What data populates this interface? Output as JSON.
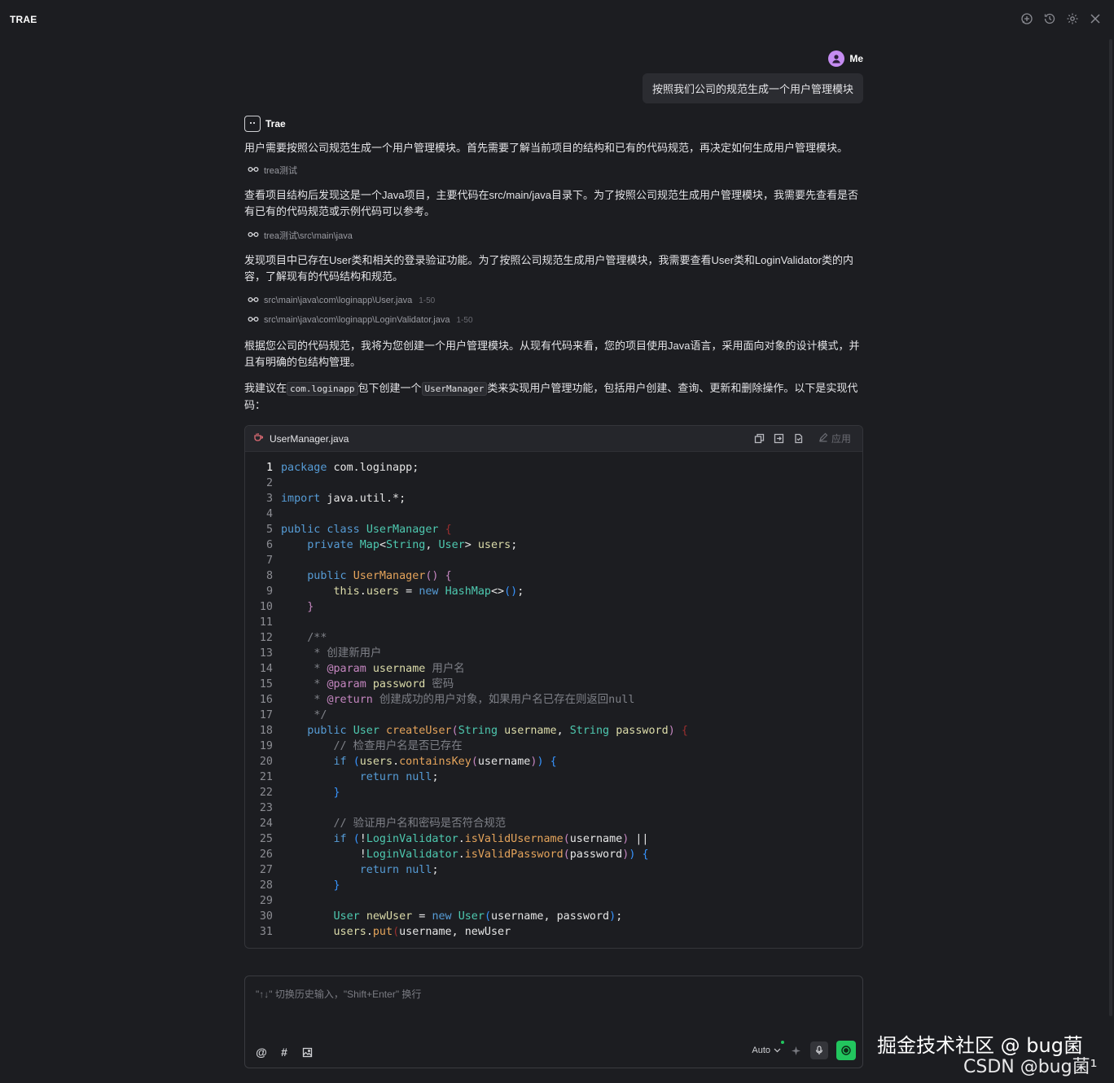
{
  "app": {
    "brand": "TRAE"
  },
  "user": {
    "name": "Me",
    "message": "按照我们公司的规范生成一个用户管理模块"
  },
  "assistant": {
    "name": "Trae",
    "p1": "用户需要按照公司规范生成一个用户管理模块。首先需要了解当前项目的结构和已有的代码规范，再决定如何生成用户管理模块。",
    "ref1": "trea测试",
    "p2": "查看项目结构后发现这是一个Java项目，主要代码在src/main/java目录下。为了按照公司规范生成用户管理模块，我需要先查看是否有已有的代码规范或示例代码可以参考。",
    "ref2": "trea测试\\src\\main\\java",
    "p3": "发现项目中已存在User类和相关的登录验证功能。为了按照公司规范生成用户管理模块，我需要查看User类和LoginValidator类的内容，了解现有的代码结构和规范。",
    "ref3": {
      "path": "src\\main\\java\\com\\loginapp\\User.java",
      "range": "1-50"
    },
    "ref4": {
      "path": "src\\main\\java\\com\\loginapp\\LoginValidator.java",
      "range": "1-50"
    },
    "p4": "根据您公司的代码规范，我将为您创建一个用户管理模块。从现有代码来看，您的项目使用Java语言，采用面向对象的设计模式，并且有明确的包结构管理。",
    "p5_a": "我建议在",
    "p5_code1": "com.loginapp",
    "p5_b": "包下创建一个",
    "p5_code2": "UserManager",
    "p5_c": "类来实现用户管理功能，包括用户创建、查询、更新和删除操作。以下是实现代码："
  },
  "code_block": {
    "filename": "UserManager.java",
    "apply_label": "应用",
    "lines": [
      [
        [
          "kw",
          "package"
        ],
        [
          "t",
          " com.loginapp;"
        ]
      ],
      [],
      [
        [
          "kw",
          "import"
        ],
        [
          "t",
          " java.util.*;"
        ]
      ],
      [],
      [
        [
          "kw",
          "public class"
        ],
        [
          "t",
          " "
        ],
        [
          "ty",
          "UserManager"
        ],
        [
          "t",
          " "
        ],
        [
          "rb",
          "{"
        ]
      ],
      [
        [
          "t",
          "    "
        ],
        [
          "kw",
          "private"
        ],
        [
          "t",
          " "
        ],
        [
          "ty",
          "Map"
        ],
        [
          "t",
          "<"
        ],
        [
          "ty",
          "String"
        ],
        [
          "t",
          ", "
        ],
        [
          "ty",
          "User"
        ],
        [
          "t",
          "> "
        ],
        [
          "v",
          "users"
        ],
        [
          "t",
          ";"
        ]
      ],
      [],
      [
        [
          "t",
          "    "
        ],
        [
          "kw",
          "public"
        ],
        [
          "t",
          " "
        ],
        [
          "fn",
          "UserManager"
        ],
        [
          "pb",
          "()"
        ],
        [
          "t",
          " "
        ],
        [
          "pb",
          "{"
        ]
      ],
      [
        [
          "t",
          "        "
        ],
        [
          "v",
          "this"
        ],
        [
          "t",
          "."
        ],
        [
          "v",
          "users"
        ],
        [
          "t",
          " = "
        ],
        [
          "kw",
          "new"
        ],
        [
          "t",
          " "
        ],
        [
          "ty",
          "HashMap"
        ],
        [
          "t",
          "<>"
        ],
        [
          "bb",
          "()"
        ],
        [
          "t",
          ";"
        ]
      ],
      [
        [
          "t",
          "    "
        ],
        [
          "pb",
          "}"
        ]
      ],
      [],
      [
        [
          "t",
          "    "
        ],
        [
          "cm",
          "/**"
        ]
      ],
      [
        [
          "t",
          "     "
        ],
        [
          "cm",
          "* 创建新用户"
        ]
      ],
      [
        [
          "t",
          "     "
        ],
        [
          "cm",
          "* "
        ],
        [
          "an",
          "@param"
        ],
        [
          "t",
          " "
        ],
        [
          "v",
          "username"
        ],
        [
          "cm",
          " 用户名"
        ]
      ],
      [
        [
          "t",
          "     "
        ],
        [
          "cm",
          "* "
        ],
        [
          "an",
          "@param"
        ],
        [
          "t",
          " "
        ],
        [
          "v",
          "password"
        ],
        [
          "cm",
          " 密码"
        ]
      ],
      [
        [
          "t",
          "     "
        ],
        [
          "cm",
          "* "
        ],
        [
          "an",
          "@return"
        ],
        [
          "cm",
          " 创建成功的用户对象，如果用户名已存在则返回null"
        ]
      ],
      [
        [
          "t",
          "     "
        ],
        [
          "cm",
          "*/"
        ]
      ],
      [
        [
          "t",
          "    "
        ],
        [
          "kw",
          "public"
        ],
        [
          "t",
          " "
        ],
        [
          "ty",
          "User"
        ],
        [
          "t",
          " "
        ],
        [
          "fn",
          "createUser"
        ],
        [
          "pb",
          "("
        ],
        [
          "ty",
          "String"
        ],
        [
          "t",
          " "
        ],
        [
          "v",
          "username"
        ],
        [
          "t",
          ", "
        ],
        [
          "ty",
          "String"
        ],
        [
          "t",
          " "
        ],
        [
          "v",
          "password"
        ],
        [
          "pb",
          ")"
        ],
        [
          "t",
          " "
        ],
        [
          "rb",
          "{"
        ]
      ],
      [
        [
          "t",
          "        "
        ],
        [
          "cm",
          "// 检查用户名是否已存在"
        ]
      ],
      [
        [
          "t",
          "        "
        ],
        [
          "kw",
          "if"
        ],
        [
          "t",
          " "
        ],
        [
          "bb",
          "("
        ],
        [
          "v",
          "users"
        ],
        [
          "t",
          "."
        ],
        [
          "fn",
          "containsKey"
        ],
        [
          "pb",
          "("
        ],
        [
          "t",
          "username"
        ],
        [
          "pb",
          ")"
        ],
        [
          "bb",
          ")"
        ],
        [
          "t",
          " "
        ],
        [
          "bb",
          "{"
        ]
      ],
      [
        [
          "t",
          "            "
        ],
        [
          "kw",
          "return"
        ],
        [
          "t",
          " "
        ],
        [
          "kw",
          "null"
        ],
        [
          "t",
          ";"
        ]
      ],
      [
        [
          "t",
          "        "
        ],
        [
          "bb",
          "}"
        ]
      ],
      [],
      [
        [
          "t",
          "        "
        ],
        [
          "cm",
          "// 验证用户名和密码是否符合规范"
        ]
      ],
      [
        [
          "t",
          "        "
        ],
        [
          "kw",
          "if"
        ],
        [
          "t",
          " "
        ],
        [
          "bb",
          "("
        ],
        [
          "t",
          "!"
        ],
        [
          "ty",
          "LoginValidator"
        ],
        [
          "t",
          "."
        ],
        [
          "fn",
          "isValidUsername"
        ],
        [
          "pb",
          "("
        ],
        [
          "t",
          "username"
        ],
        [
          "pb",
          ")"
        ],
        [
          "t",
          " ||"
        ]
      ],
      [
        [
          "t",
          "            !"
        ],
        [
          "ty",
          "LoginValidator"
        ],
        [
          "t",
          "."
        ],
        [
          "fn",
          "isValidPassword"
        ],
        [
          "pb",
          "("
        ],
        [
          "t",
          "password"
        ],
        [
          "pb",
          ")"
        ],
        [
          "bb",
          ")"
        ],
        [
          "t",
          " "
        ],
        [
          "bb",
          "{"
        ]
      ],
      [
        [
          "t",
          "            "
        ],
        [
          "kw",
          "return"
        ],
        [
          "t",
          " "
        ],
        [
          "kw",
          "null"
        ],
        [
          "t",
          ";"
        ]
      ],
      [
        [
          "t",
          "        "
        ],
        [
          "bb",
          "}"
        ]
      ],
      [],
      [
        [
          "t",
          "        "
        ],
        [
          "ty",
          "User"
        ],
        [
          "t",
          " "
        ],
        [
          "v",
          "newUser"
        ],
        [
          "t",
          " = "
        ],
        [
          "kw",
          "new"
        ],
        [
          "t",
          " "
        ],
        [
          "ty",
          "User"
        ],
        [
          "bb",
          "("
        ],
        [
          "t",
          "username, password"
        ],
        [
          "bb",
          ")"
        ],
        [
          "t",
          ";"
        ]
      ],
      [
        [
          "t",
          "        "
        ],
        [
          "v",
          "users"
        ],
        [
          "t",
          "."
        ],
        [
          "fn",
          "put"
        ],
        [
          "rb",
          "("
        ],
        [
          "t",
          "username, newUser"
        ]
      ]
    ]
  },
  "input": {
    "placeholder": "\"↑↓\" 切换历史输入，\"Shift+Enter\" 换行",
    "mode": "Auto"
  },
  "watermark": {
    "line1": "掘金技术社区 @ bug菌",
    "line2": "CSDN @bug菌¹"
  },
  "colors": {
    "kw": "#569cd6",
    "ty": "#4ec9b0",
    "fn": "#e5a45b",
    "v": "#dcdcaa",
    "cm": "#7e8087",
    "an": "#c586c0",
    "pb": "#c586c0",
    "bb": "#3794ff",
    "rb": "#9b2f2f",
    "t": "#e6e6e6",
    "send": "#22c55e"
  }
}
